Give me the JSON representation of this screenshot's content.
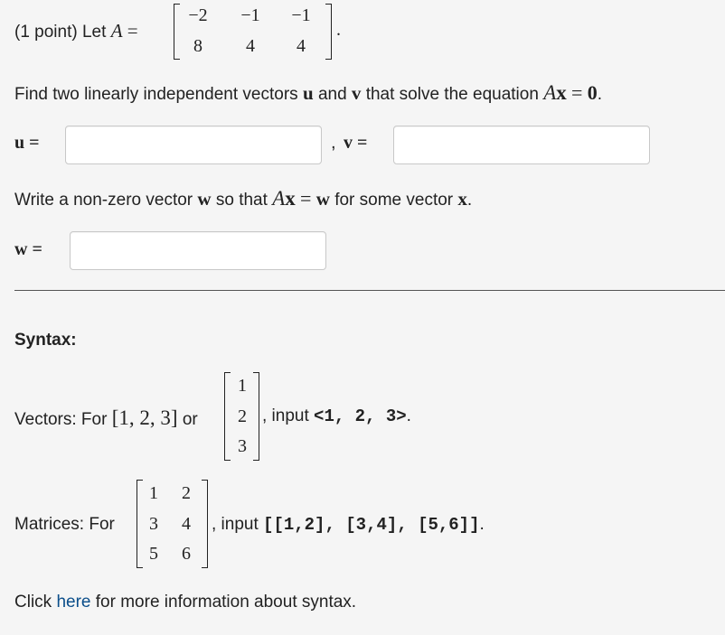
{
  "problem": {
    "points_label": "(1 point) Let",
    "matrix_name": "A",
    "eq": "=",
    "matrix_A": [
      [
        "−2",
        "−1",
        "−1"
      ],
      [
        "8",
        "4",
        "4"
      ]
    ],
    "period": "."
  },
  "part1": {
    "text_a": "Find two linearly independent vectors",
    "u": "u",
    "and": "and",
    "v": "v",
    "text_b": "that solve the equation",
    "A": "A",
    "x": "x",
    "eq": "=",
    "zero": "0",
    "period": "."
  },
  "answers": {
    "u_label": "u =",
    "sep": ",",
    "v_label": "v =",
    "u_value": "",
    "v_value": "",
    "w_label": "w =",
    "w_value": ""
  },
  "part2": {
    "text_a": "Write a non-zero vector",
    "w": "w",
    "text_b": "so that",
    "A": "A",
    "x": "x",
    "eq": "=",
    "w2": "w",
    "text_c": "for some vector",
    "x2": "x",
    "period": "."
  },
  "syntax": {
    "heading": "Syntax:",
    "vectors_prefix": "Vectors: For",
    "vector_row": "[1, 2, 3]",
    "or": "or",
    "vector_col": [
      "1",
      "2",
      "3"
    ],
    "vectors_input": ", input",
    "vectors_code": "<1, 2, 3>",
    "vectors_end": ".",
    "matrices_prefix": "Matrices: For",
    "matrix_ex": [
      [
        "1",
        "2"
      ],
      [
        "3",
        "4"
      ],
      [
        "5",
        "6"
      ]
    ],
    "matrices_input": ", input",
    "matrices_code": "[[1,2], [3,4], [5,6]]",
    "matrices_end": ".",
    "click": "Click",
    "here": "here",
    "more": "for more information about syntax."
  }
}
